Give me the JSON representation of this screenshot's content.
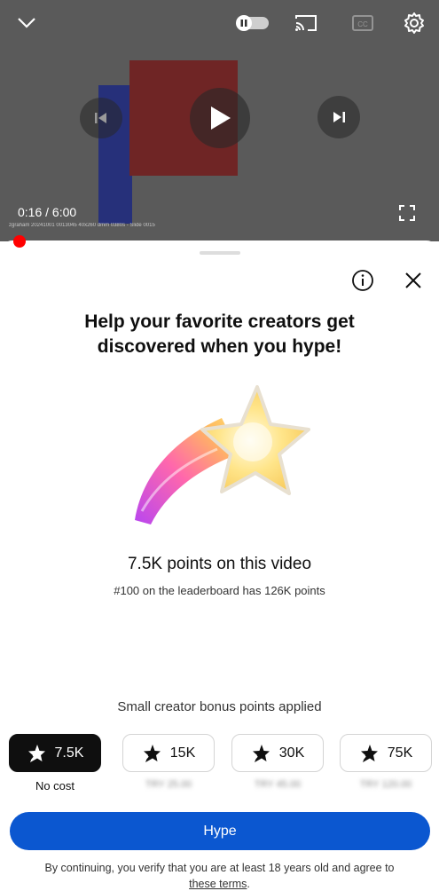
{
  "player": {
    "time_current": "0:16",
    "time_separator": " / ",
    "time_total": "6:00",
    "caption": "zgraham 20241001 0013045 40x260 dmm 0380s - Slide 0015",
    "progress": 0.044
  },
  "sheet": {
    "headline": "Help your favorite creators get discovered when you hype!",
    "points_title": "7.5K points on this video",
    "leaderboard_text": "#100 on the leaderboard has 126K points",
    "bonus_text": "Small creator bonus points applied",
    "options": [
      {
        "label": "7.5K",
        "sub": "No cost",
        "selected": true
      },
      {
        "label": "15K",
        "sub": "TRY 25.00",
        "selected": false
      },
      {
        "label": "30K",
        "sub": "TRY 45.00",
        "selected": false
      },
      {
        "label": "75K",
        "sub": "TRY 120.00",
        "selected": false
      }
    ],
    "hype_label": "Hype",
    "terms_text": "By continuing, you verify that you are at least 18 years old and agree to",
    "terms_link": "these terms",
    "terms_end": "."
  },
  "colors": {
    "accent": "#0b57d0",
    "progress": "#ff0000",
    "selected_option": "#0f0f0f"
  },
  "icons": [
    "chevron-down-icon",
    "pause-icon",
    "cast-icon",
    "captions-icon",
    "gear-icon",
    "previous-icon",
    "play-icon",
    "next-icon",
    "fullscreen-icon",
    "info-icon",
    "close-icon",
    "hype-star-icon"
  ]
}
